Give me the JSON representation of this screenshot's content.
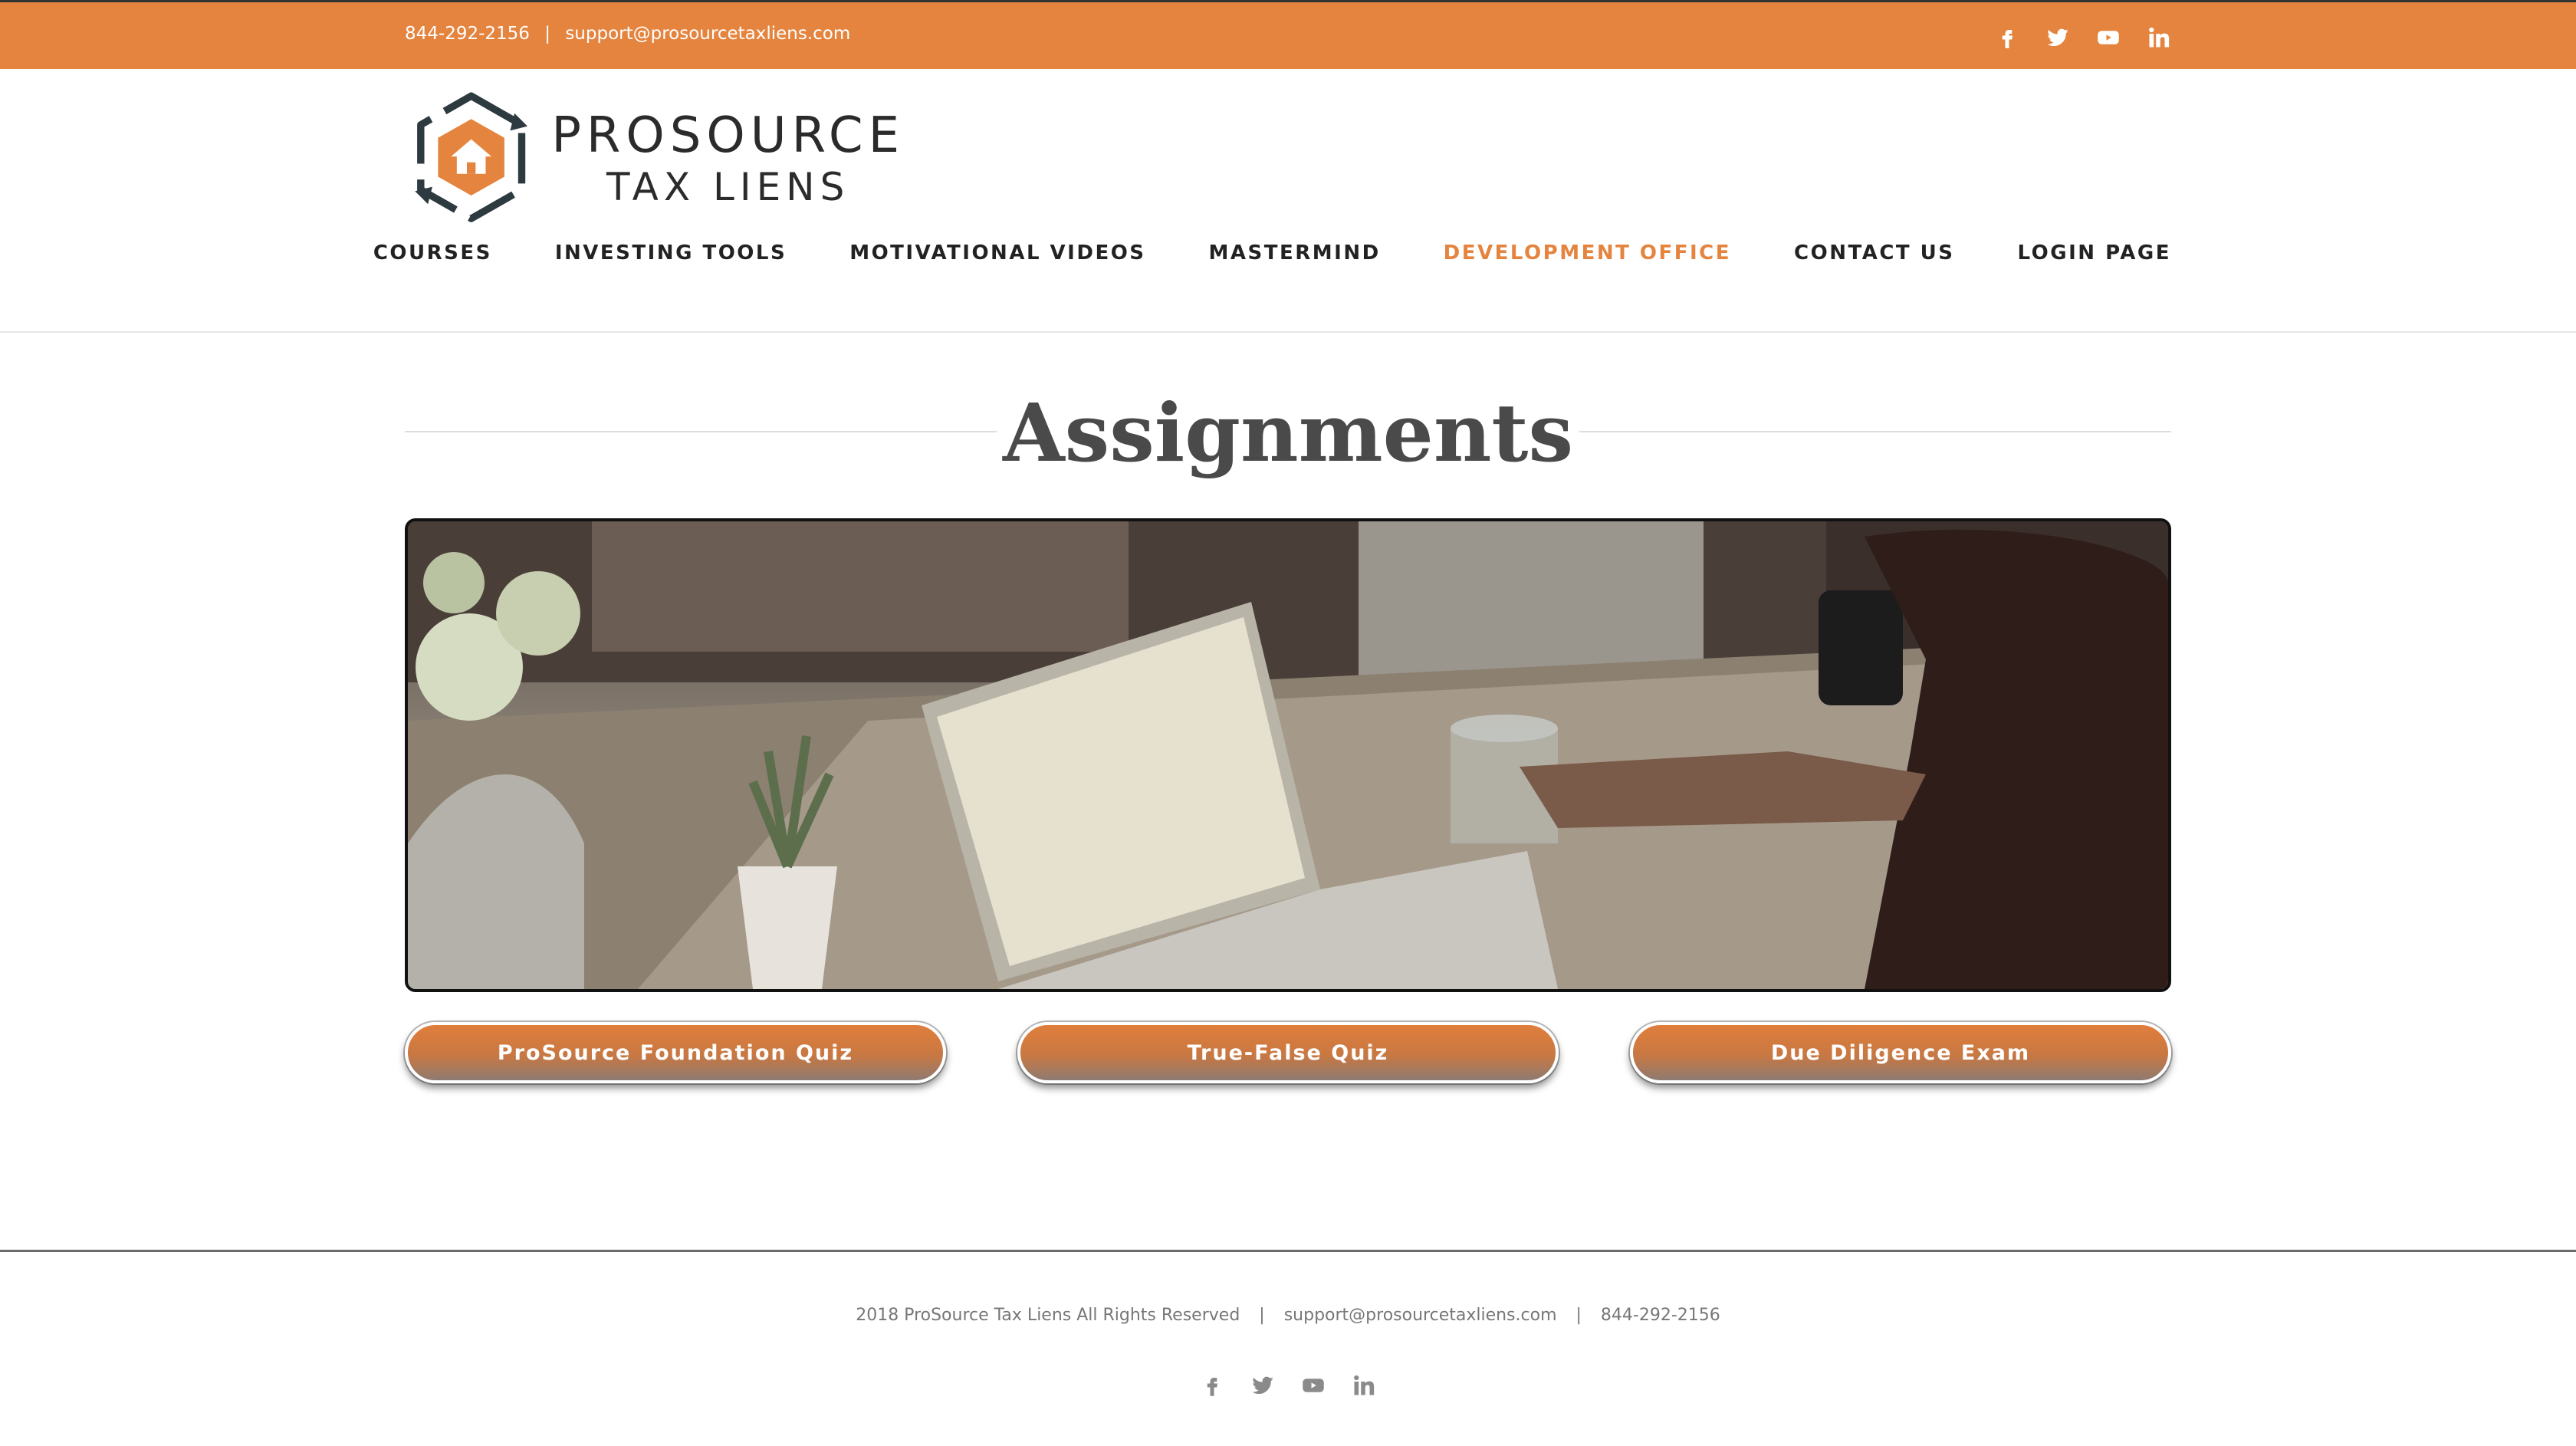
{
  "topbar": {
    "phone": "844-292-2156",
    "separator": "|",
    "email": "support@prosourcetaxliens.com",
    "social_icons": [
      "facebook-icon",
      "twitter-icon",
      "youtube-icon",
      "linkedin-icon"
    ],
    "background": "#E5843E"
  },
  "logo": {
    "line1": "PROSOURCE",
    "line2": "TAX LIENS"
  },
  "nav": {
    "items": [
      {
        "label": "COURSES"
      },
      {
        "label": "INVESTING TOOLS"
      },
      {
        "label": "MOTIVATIONAL VIDEOS"
      },
      {
        "label": "MASTERMIND"
      },
      {
        "label": "DEVELOPMENT OFFICE",
        "active": true
      },
      {
        "label": "CONTACT US"
      },
      {
        "label": "LOGIN PAGE"
      }
    ],
    "active_color": "#E5843E"
  },
  "page": {
    "title": "Assignments"
  },
  "buttons": {
    "quiz1": "ProSource Foundation Quiz",
    "quiz2": "True-False Quiz",
    "quiz3": "Due Diligence Exam"
  },
  "footer": {
    "copyright": "2018 ProSource Tax Liens All Rights Reserved",
    "separator": "|",
    "email": "support@prosourcetaxliens.com",
    "phone": "844-292-2156",
    "social_icons": [
      "facebook-icon",
      "twitter-icon",
      "youtube-icon",
      "linkedin-icon"
    ]
  }
}
